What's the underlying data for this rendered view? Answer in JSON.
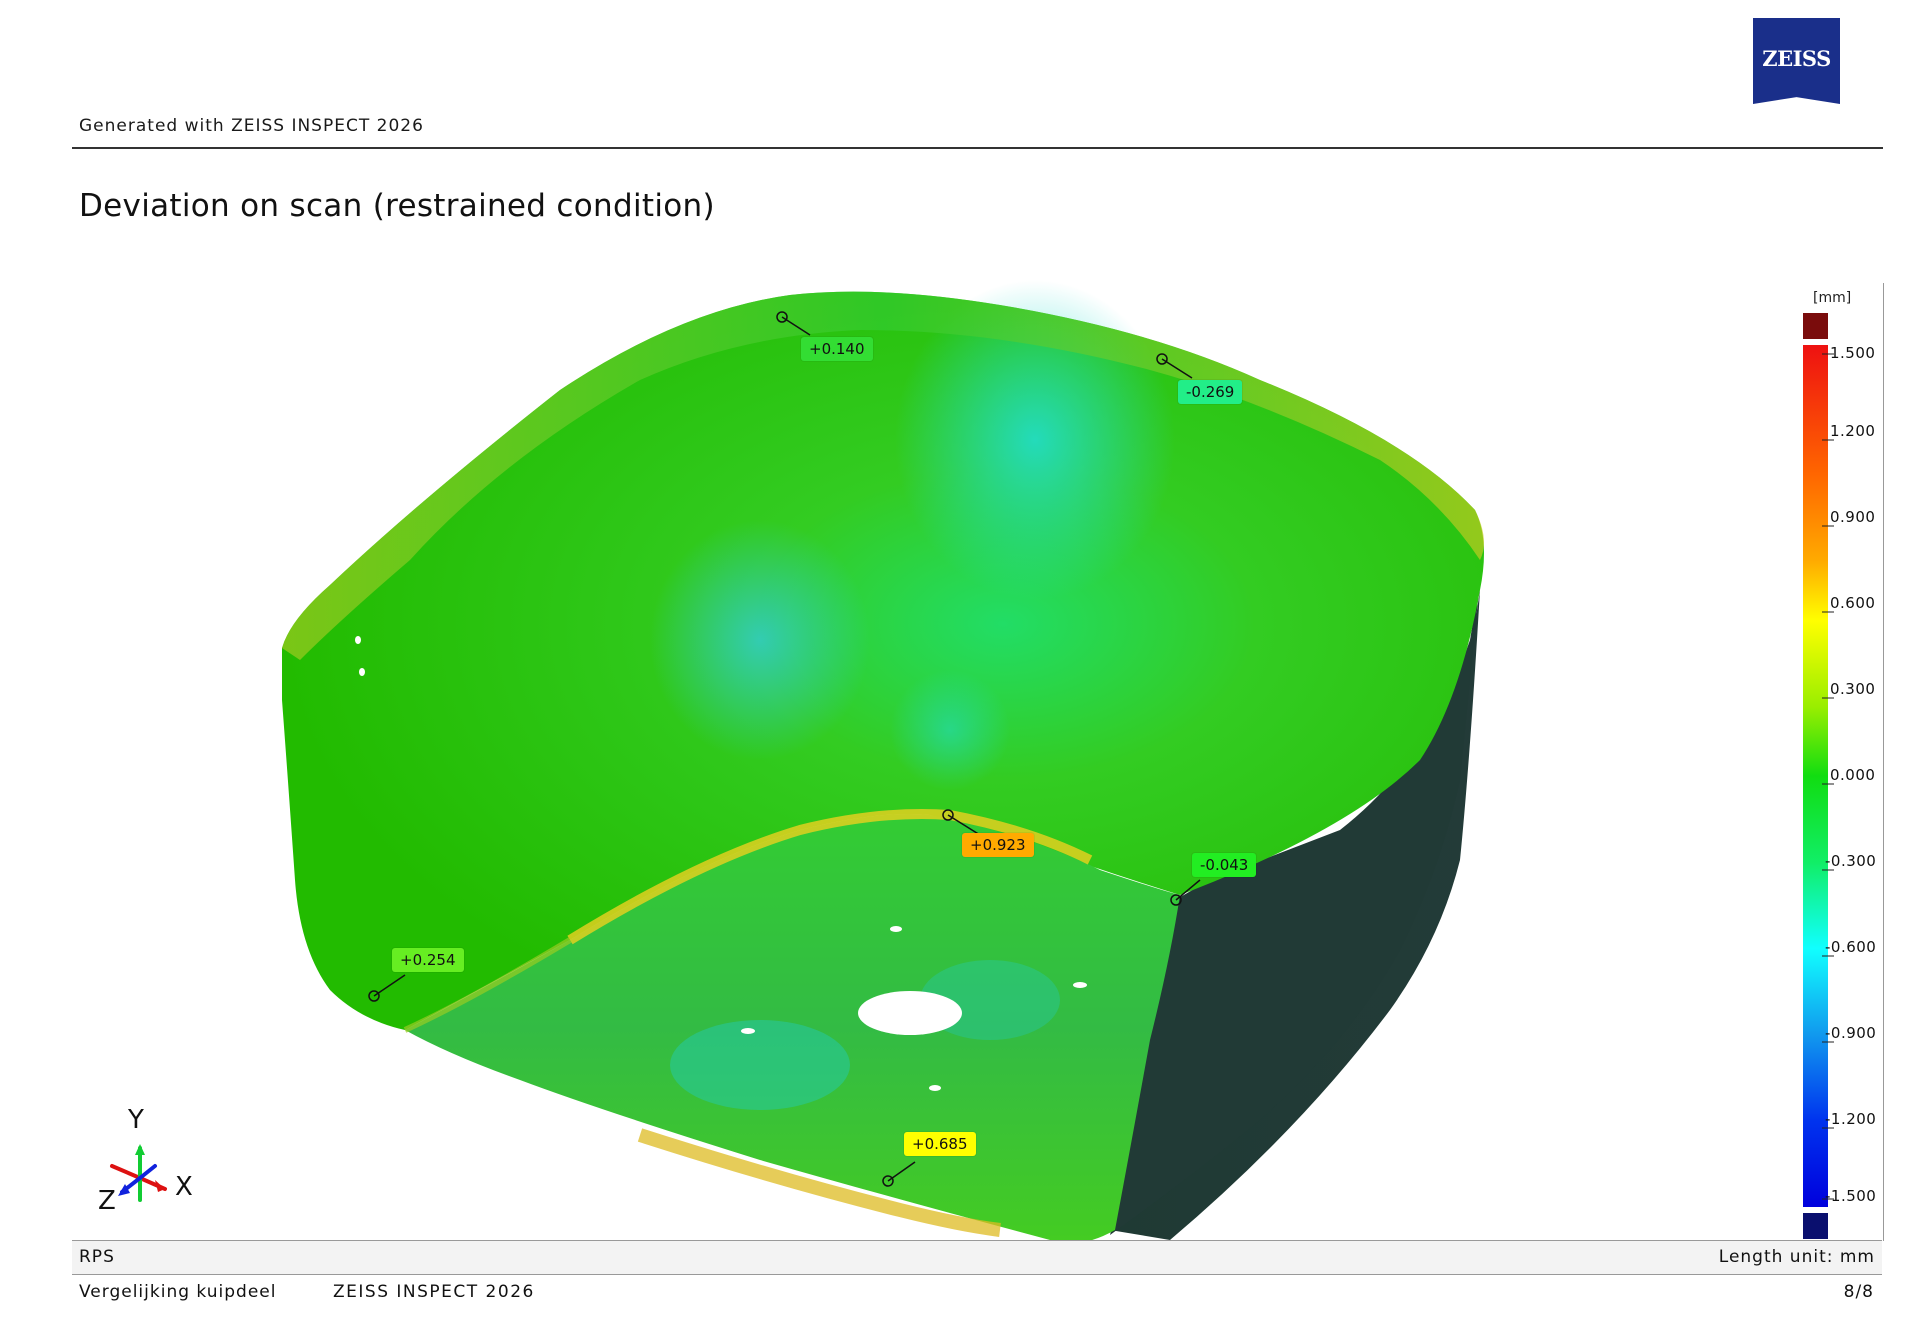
{
  "header": {
    "logo_text": "ZEISS",
    "generated_with": "Generated with ZEISS INSPECT 2026",
    "brand_color": "#1a2f8a"
  },
  "title": "Deviation on scan (restrained condition)",
  "callouts": [
    {
      "value": "+0.140",
      "color": "#33dd33"
    },
    {
      "value": "-0.269",
      "color": "#22ee88"
    },
    {
      "value": "+0.923",
      "color": "#ffaa00"
    },
    {
      "value": "-0.043",
      "color": "#22ee22"
    },
    {
      "value": "+0.254",
      "color": "#66ee22"
    },
    {
      "value": "+0.685",
      "color": "#ffff00"
    }
  ],
  "color_scale": {
    "unit": "[mm]",
    "ticks": [
      "1.500",
      "1.200",
      "0.900",
      "0.600",
      "0.300",
      "0.000",
      "-0.300",
      "-0.600",
      "-0.900",
      "-1.200",
      "-1.500"
    ],
    "over_color": "#7a0c0c",
    "under_color": "#0a0f6e"
  },
  "axes": {
    "x": "X",
    "y": "Y",
    "z": "Z"
  },
  "footer": {
    "alignment": "RPS",
    "length_unit": "Length unit: mm",
    "project": "Vergelijking kuipdeel",
    "software": "ZEISS INSPECT 2026",
    "page": "8/8"
  }
}
